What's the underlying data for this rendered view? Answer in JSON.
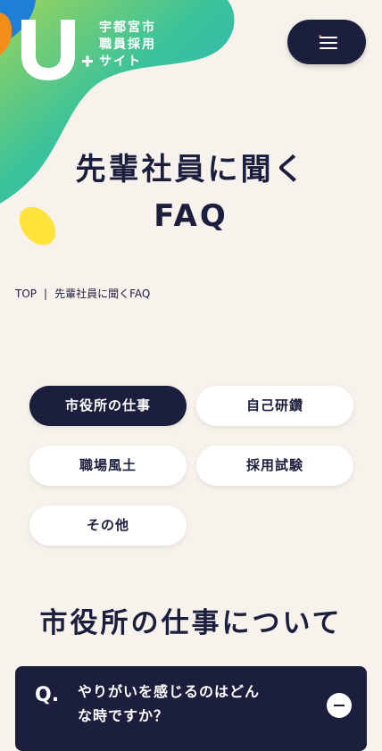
{
  "header": {
    "logo_text": "U+",
    "site_title_lines": [
      "宇都宮市",
      "職員採用",
      "サイト"
    ],
    "menu_icon": "hamburger-icon"
  },
  "page": {
    "title_lines": [
      "先輩社員に聞く",
      "FAQ"
    ]
  },
  "breadcrumb": {
    "home": "TOP",
    "separator": "|",
    "current": "先輩社員に聞くFAQ"
  },
  "tabs": [
    {
      "label": "市役所の仕事",
      "active": true
    },
    {
      "label": "自己研鑽",
      "active": false
    },
    {
      "label": "職場風土",
      "active": false
    },
    {
      "label": "採用試験",
      "active": false
    },
    {
      "label": "その他",
      "active": false
    }
  ],
  "section": {
    "heading": "市役所の仕事について"
  },
  "faq": {
    "q_mark": "Q.",
    "question_lines": [
      "やりがいを感じるのはどん",
      "な時ですか？"
    ],
    "toggle_icon": "minus-icon"
  },
  "colors": {
    "navy": "#1b1e3d",
    "background": "#f7f3ec",
    "teal": "#2ab8b0",
    "green": "#9bd45a",
    "yellow": "#ffe23a",
    "orange": "#f28d1a",
    "blue": "#1e7fd8"
  }
}
